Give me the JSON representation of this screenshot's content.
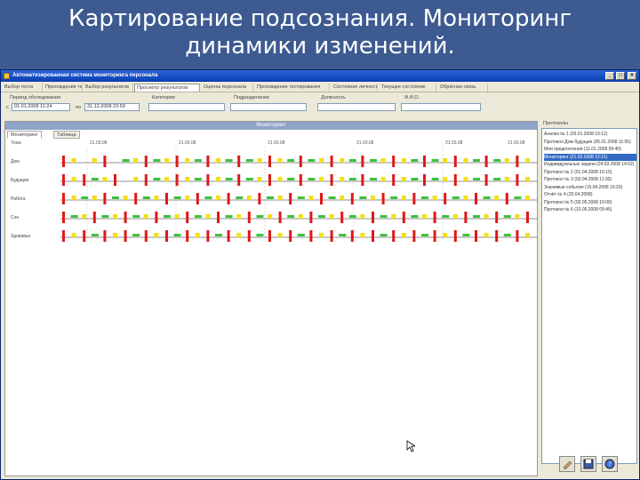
{
  "slide": {
    "title_line1": "Картирование подсознания. Мониторинг",
    "title_line2": "динамики изменений."
  },
  "window": {
    "title": "Автоматизированная система мониторинга персонала",
    "controls": [
      "_",
      "□",
      "×"
    ]
  },
  "menu": {
    "items": [
      "Выбор теста",
      "Прохождение теста",
      "Выбор результатов",
      "Просмотр результатов",
      "Оценка персонала",
      "Прохождение тестирования",
      "Состояние личности",
      "Текущее состояние",
      "Обратная связь"
    ],
    "active_index": 3
  },
  "filters": {
    "period_label": "Период обследования",
    "from_prefix": "с",
    "from_value": "01.01.2008 11:24",
    "to_prefix": "по",
    "to_value": "31.12.2008 23:59",
    "group_label": "Категория",
    "group_value": "",
    "unit_label": "Подразделение",
    "unit_value": "",
    "position_label": "Должность",
    "position_value": "",
    "name_label": "Ф.И.О.",
    "name_value": ""
  },
  "chart_panel": {
    "header": "Мониторинг",
    "tabs": [
      "Мониторинг",
      "Таблица"
    ],
    "active_tab": 0,
    "row_header": "Тема",
    "dates": [
      "21.03.08",
      "21.03.08",
      "21.03.08",
      "21.03.08",
      "21.03.08",
      "21.03.08"
    ]
  },
  "chart_data": {
    "type": "table",
    "rows": [
      "Дом",
      "Будущее",
      "Работа",
      "Сон",
      "Здоровье"
    ],
    "columns": 46,
    "status_colors": {
      "negative": "#e01818",
      "neutral": "#f2e01a",
      "positive": "#3cc23c"
    },
    "cells": [
      [
        "r",
        "y",
        "n",
        "y",
        "r",
        "n",
        "g",
        "y",
        "r",
        "g",
        "y",
        "r",
        "y",
        "g",
        "r",
        "y",
        "g",
        "r",
        "g",
        "y",
        "r",
        "y",
        "g",
        "r",
        "g",
        "y",
        "r",
        "y",
        "g",
        "r",
        "g",
        "y",
        "r",
        "y",
        "g",
        "r",
        "g",
        "y",
        "r",
        "y",
        "g",
        "r",
        "g",
        "y",
        "r",
        "y"
      ],
      [
        "r",
        "y",
        "r",
        "g",
        "y",
        "r",
        "n",
        "y",
        "r",
        "g",
        "y",
        "r",
        "y",
        "g",
        "r",
        "y",
        "g",
        "r",
        "g",
        "y",
        "r",
        "y",
        "g",
        "r",
        "g",
        "y",
        "r",
        "y",
        "g",
        "r",
        "g",
        "y",
        "r",
        "y",
        "g",
        "r",
        "g",
        "y",
        "r",
        "y",
        "g",
        "r",
        "g",
        "y",
        "r",
        "y"
      ],
      [
        "r",
        "y",
        "g",
        "y",
        "r",
        "g",
        "y",
        "r",
        "g",
        "y",
        "r",
        "g",
        "y",
        "r",
        "g",
        "y",
        "r",
        "g",
        "y",
        "r",
        "g",
        "y",
        "r",
        "g",
        "y",
        "r",
        "g",
        "y",
        "r",
        "g",
        "y",
        "r",
        "g",
        "y",
        "r",
        "g",
        "y",
        "r",
        "g",
        "y",
        "r",
        "g",
        "y",
        "r",
        "g",
        "y"
      ],
      [
        "r",
        "g",
        "y",
        "r",
        "g",
        "y",
        "r",
        "g",
        "y",
        "r",
        "g",
        "y",
        "r",
        "g",
        "y",
        "r",
        "g",
        "y",
        "r",
        "g",
        "y",
        "r",
        "g",
        "y",
        "r",
        "g",
        "y",
        "r",
        "g",
        "y",
        "r",
        "g",
        "y",
        "r",
        "g",
        "y",
        "r",
        "g",
        "y",
        "r",
        "g",
        "y",
        "r",
        "g",
        "y",
        "r"
      ],
      [
        "r",
        "y",
        "r",
        "g",
        "r",
        "y",
        "r",
        "g",
        "r",
        "y",
        "r",
        "g",
        "r",
        "y",
        "r",
        "g",
        "r",
        "y",
        "r",
        "g",
        "r",
        "y",
        "r",
        "g",
        "r",
        "y",
        "r",
        "g",
        "r",
        "y",
        "r",
        "g",
        "r",
        "y",
        "r",
        "g",
        "r",
        "y",
        "r",
        "g",
        "r",
        "y",
        "r",
        "g",
        "r",
        "y"
      ]
    ]
  },
  "side_panel": {
    "title": "Протоколы",
    "items": [
      "Анализ № 1 (03.01.2008 10:12)",
      "Протокол Дом будущее (05.01.2008 11:05)",
      "Мои предпочтения (11.01.2008 09:40)",
      "Мониторинг (21.03.2008 12:21)",
      "Индивидуальные задачи (24.03.2008 14:02)",
      "Протокол № 2 (01.04.2008 10:15)",
      "Протокол № 3 (02.04.2008 11:30)",
      "Значимые события (15.04.2008 16:20)",
      "Отчёт № 4 (20.04.2008)",
      "Протокол № 5 (02.05.2008 10:00)",
      "Протокол № 6 (10.05.2008 09:45)"
    ],
    "selected_index": 3
  },
  "actions": {
    "icons": [
      "edit-icon",
      "save-icon",
      "help-icon"
    ]
  }
}
